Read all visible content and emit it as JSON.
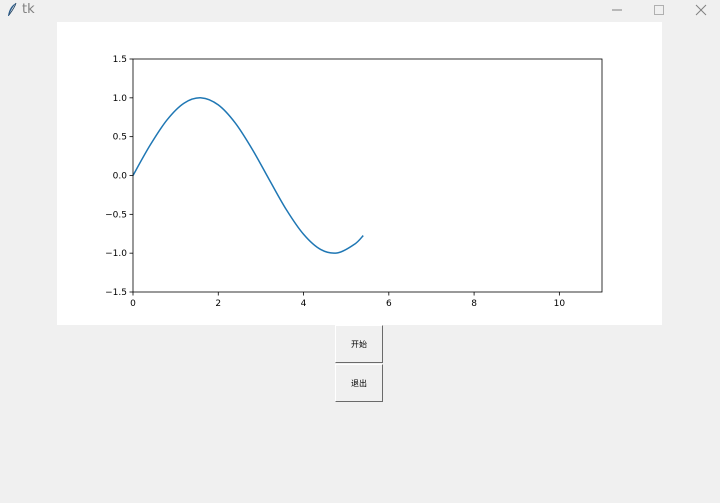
{
  "window": {
    "title": "tk"
  },
  "buttons": {
    "start_label": "开始",
    "quit_label": "退出"
  },
  "chart_data": {
    "type": "line",
    "title": "",
    "xlabel": "",
    "ylabel": "",
    "xlim": [
      0,
      11
    ],
    "ylim": [
      -1.5,
      1.5
    ],
    "x_ticks": [
      "0",
      "2",
      "4",
      "6",
      "8",
      "10"
    ],
    "y_ticks": [
      "1.5",
      "1.0",
      "0.5",
      "0.0",
      "−0.5",
      "−1.0",
      "−1.5"
    ],
    "grid": false,
    "series": [
      {
        "color": "#1f77b4",
        "x": [
          0,
          0.4,
          0.8,
          1.2,
          1.6,
          2.0,
          2.4,
          2.8,
          3.2,
          3.6,
          4.0,
          4.4,
          4.8,
          5.2,
          5.4
        ],
        "y": [
          0,
          0.389,
          0.717,
          0.932,
          1.0,
          0.909,
          0.675,
          0.335,
          -0.058,
          -0.443,
          -0.757,
          -0.952,
          -0.996,
          -0.883,
          -0.773
        ]
      }
    ]
  }
}
